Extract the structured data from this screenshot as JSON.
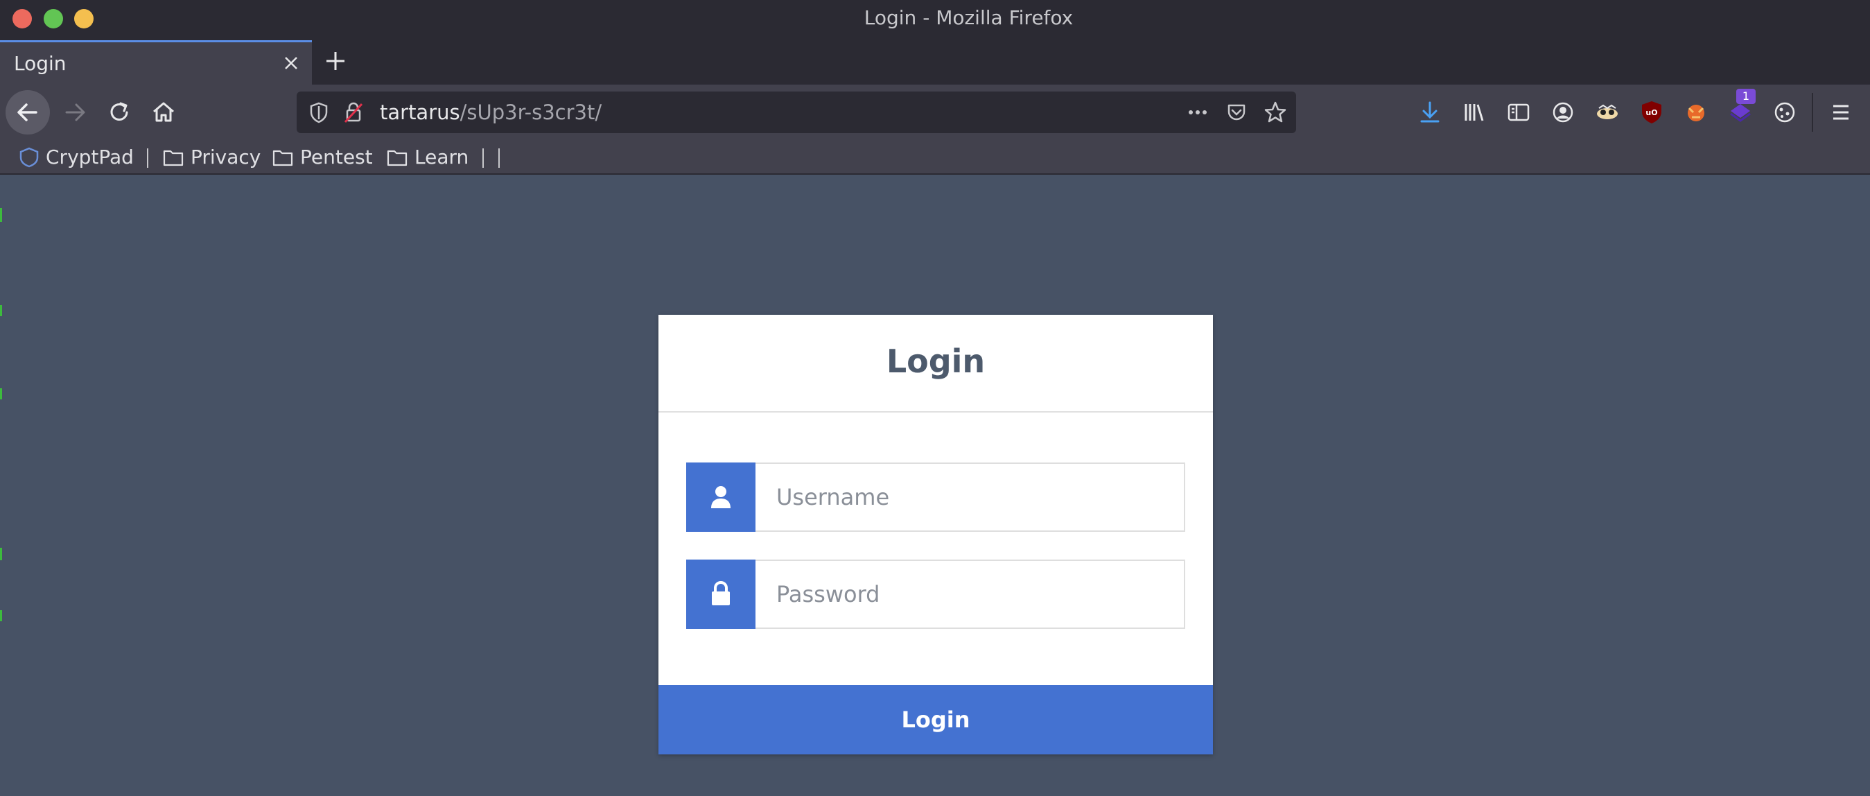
{
  "window": {
    "title": "Login - Mozilla Firefox"
  },
  "tabs": [
    {
      "label": "Login",
      "active": true
    }
  ],
  "urlbar": {
    "host": "tartarus",
    "path": "/sUp3r-s3cr3t/"
  },
  "toolbar": {
    "icons": [
      "download-icon",
      "library-icon",
      "sidebar-icon",
      "account-icon",
      "extension-icon",
      "ublock-icon",
      "extension-icon",
      "extension-icon",
      "cookie-icon",
      "menu-icon"
    ],
    "extension_badge": "1"
  },
  "bookmarks": [
    {
      "label": "CryptPad",
      "icon": "cryptpad-icon"
    },
    {
      "label": "Privacy",
      "icon": "folder-icon"
    },
    {
      "label": "Pentest",
      "icon": "folder-icon"
    },
    {
      "label": "Learn",
      "icon": "folder-icon"
    }
  ],
  "login": {
    "title": "Login",
    "username_placeholder": "Username",
    "password_placeholder": "Password",
    "button_label": "Login"
  },
  "colors": {
    "page_bg": "#475265",
    "accent": "#4472d1",
    "card_bg": "#ffffff",
    "title_color": "#4d5a6c"
  }
}
